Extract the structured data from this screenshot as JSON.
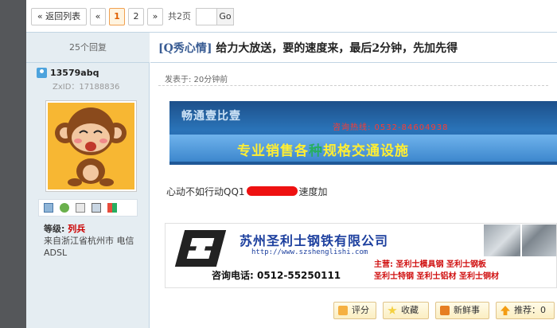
{
  "pager": {
    "back_label": "« 返回列表",
    "prev_label": "«",
    "pages": [
      "1",
      "2"
    ],
    "current_page": "1",
    "next_label": "»",
    "total_label": "共2页",
    "go_label": "Go"
  },
  "thread": {
    "replies_label": "25个回复",
    "category": "[Q秀心情]",
    "title": "给力大放送，要的速度来，最后2分钟，先加先得"
  },
  "user": {
    "username": "13579abq",
    "zxid_label": "ZxID：17188836",
    "rank_prefix": "等级:",
    "rank_value": "列兵",
    "location": "来自浙江省杭州市 电信ADSL"
  },
  "user_icons": [
    "mail-icon",
    "add-friend-icon",
    "profile-icon",
    "photo-icon",
    "group-icon"
  ],
  "post": {
    "time_label": "发表于: 20分钟前",
    "message_before": "心动不如行动QQ1",
    "message_after": "速度加"
  },
  "banner1": {
    "title": "畅通壹比壹",
    "hotline": "咨询热线: 0532-84604938",
    "slogan_part1": "专业销售各",
    "slogan_part2": "种",
    "slogan_part3": "规格交通设施"
  },
  "banner2": {
    "company": "苏州圣利士钢铁有限公司",
    "url": "http://www.szshenglishi.com",
    "phone": "咨询电话: 0512-55250111",
    "business_line1": "主营: 圣利士模具钢 圣利士钢板",
    "business_line2": "圣利士特钢 圣利士铝材 圣利士铜材"
  },
  "actions": {
    "rate_label": "评分",
    "favorite_label": "收藏",
    "fresh_label": "新鲜事",
    "recommend_label": "推荐：0"
  },
  "colors": {
    "accent_blue": "#1c3f9e",
    "current_page": "#e06000",
    "red_text": "#d01010",
    "yellow_text": "#ffee33",
    "side_bg": "#e5edf2",
    "border": "#c2d5e3"
  }
}
